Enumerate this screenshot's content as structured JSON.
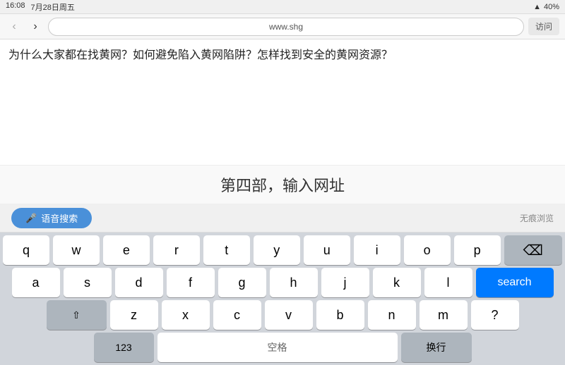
{
  "statusBar": {
    "time": "16:08",
    "date": "7月28日周五",
    "battery": "40%",
    "batteryIcon": "🔋"
  },
  "navBar": {
    "backIcon": "‹",
    "forwardIcon": "›",
    "urlText": "www.shg",
    "visitLabel": "访问"
  },
  "content": {
    "articleText": "为什么大家都在找黄网？如何避免陷入黄网陷阱？怎样找到安全的黄网资源？"
  },
  "centerSection": {
    "text": "第四部，输入网址"
  },
  "voiceBar": {
    "micIcon": "🎤",
    "voiceSearchLabel": "语音搜索",
    "incognitoLabel": "无痕浏览"
  },
  "keyboard": {
    "row1": [
      "q",
      "w",
      "e",
      "r",
      "t",
      "y",
      "u",
      "i",
      "o",
      "p"
    ],
    "row2": [
      "a",
      "s",
      "d",
      "f",
      "g",
      "h",
      "j",
      "k",
      "l"
    ],
    "row3": [
      "z",
      "x",
      "c",
      "v",
      "b",
      "n",
      "m"
    ],
    "searchLabel": "search",
    "backspaceSymbol": "⌫",
    "shiftSymbol": "⇧",
    "key123Label": "123",
    "spaceLabel": "空格",
    "questionMark": "?",
    "returnLabel": "换行"
  }
}
